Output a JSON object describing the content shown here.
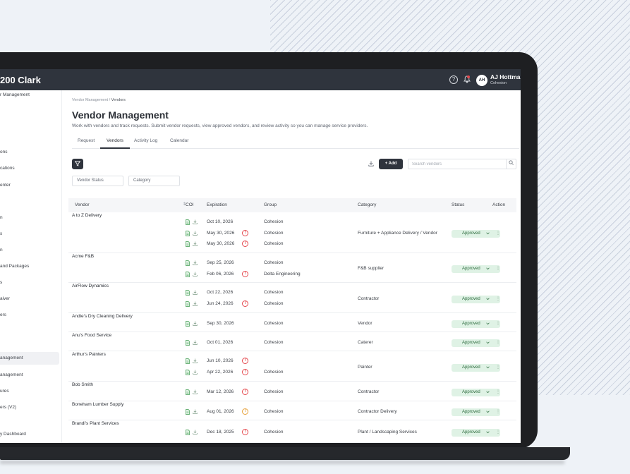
{
  "app": {
    "brand": "200 Clark",
    "user_initials": "AH",
    "user_name": "AJ Hottman",
    "user_org": "Cohesion"
  },
  "colors": {
    "topbar": "#2f343d",
    "status_approved_bg": "#dff2e5",
    "warning": "#e5484d",
    "caution": "#e7a33e",
    "coi_icon": "#3e9b4f"
  },
  "icons": {
    "help": "help-circle-icon",
    "bell": "bell-icon",
    "filter": "filter-icon",
    "download": "download-icon",
    "search": "search-icon",
    "sort": "sort-icon",
    "file": "file-icon",
    "warning": "warning-icon",
    "chevron": "chevron-down-icon",
    "more": "more-vertical-icon"
  },
  "sidebar": {
    "items": [
      {
        "label": "r Management",
        "active": false
      },
      {
        "label": "ons",
        "active": false
      },
      {
        "label": "cations",
        "active": false
      },
      {
        "label": "enter",
        "active": false
      },
      {
        "label": "n",
        "active": false
      },
      {
        "label": "s",
        "active": false
      },
      {
        "label": "n",
        "active": false
      },
      {
        "label": "and Packages",
        "active": false
      },
      {
        "label": "s",
        "active": false
      },
      {
        "label": "aiver",
        "active": false
      },
      {
        "label": "ers",
        "active": false
      },
      {
        "label": "anagement",
        "active": true
      },
      {
        "label": "anagement",
        "active": false
      },
      {
        "label": "ures",
        "active": false
      },
      {
        "label": "ers (V2)",
        "active": false
      },
      {
        "label": "y Dashboard",
        "active": false
      }
    ]
  },
  "page": {
    "breadcrumb_parent": "Vendor Management",
    "breadcrumb_sep": " / ",
    "breadcrumb_current": "Vendors",
    "title": "Vendor Management",
    "description": "Work with vendors and track requests. Submit vendor requests, view approved vendors, and review activity so you can manage service providers."
  },
  "tabs": [
    {
      "label": "Request"
    },
    {
      "label": "Vendors"
    },
    {
      "label": "Activity Log"
    },
    {
      "label": "Calendar"
    }
  ],
  "toolbar": {
    "vendor_status": "Vendor Status",
    "category": "Category",
    "add_label": "+ Add",
    "search_placeholder": "Search vendors"
  },
  "table": {
    "headers": [
      "Vendor",
      "COI",
      "Expiration",
      "Group",
      "Category",
      "Status",
      "Action"
    ],
    "rows": [
      {
        "vendor": "A to Z Delivery",
        "category": "Furniture + Appliance Delivery / Vendor",
        "status": "Approved",
        "coi": [
          {
            "exp": "Oct 10, 2026",
            "warn": "",
            "group": "Cohesion"
          },
          {
            "exp": "May 30, 2026",
            "warn": "red",
            "group": "Cohesion"
          },
          {
            "exp": "May 30, 2026",
            "warn": "red",
            "group": "Cohesion"
          }
        ]
      },
      {
        "vendor": "Acme F&B",
        "category": "F&B supplier",
        "status": "Approved",
        "coi": [
          {
            "exp": "Sep 25, 2026",
            "warn": "",
            "group": "Cohesion"
          },
          {
            "exp": "Feb 06, 2026",
            "warn": "red",
            "group": "Delta Engineering"
          }
        ]
      },
      {
        "vendor": "AirFlow Dynamics",
        "category": "Contractor",
        "status": "Approved",
        "coi": [
          {
            "exp": "Oct 22, 2026",
            "warn": "",
            "group": "Cohesion"
          },
          {
            "exp": "Jun 24, 2026",
            "warn": "red",
            "group": "Cohesion"
          }
        ]
      },
      {
        "vendor": "Andie's Dry Cleaning Delivery",
        "category": "Vendor",
        "status": "Approved",
        "coi": [
          {
            "exp": "Sep 30, 2026",
            "warn": "",
            "group": "Cohesion"
          }
        ]
      },
      {
        "vendor": "Anu's Food Service",
        "category": "Caterer",
        "status": "Approved",
        "coi": [
          {
            "exp": "Oct 01, 2026",
            "warn": "",
            "group": "Cohesion"
          }
        ]
      },
      {
        "vendor": "Arthur's Painters",
        "category": "Painter",
        "status": "Approved",
        "coi": [
          {
            "exp": "Jun 10, 2026",
            "warn": "red",
            "group": ""
          },
          {
            "exp": "Apr 22, 2026",
            "warn": "red",
            "group": "Cohesion"
          }
        ]
      },
      {
        "vendor": "Bob Smith",
        "category": "Contractor",
        "status": "Approved",
        "coi": [
          {
            "exp": "Mar 12, 2026",
            "warn": "red",
            "group": "Cohesion"
          }
        ]
      },
      {
        "vendor": "Boneham Lumber Supply",
        "category": "Contractor Delivery",
        "status": "Approved",
        "coi": [
          {
            "exp": "Aug 01, 2026",
            "warn": "amber",
            "group": "Cohesion"
          }
        ]
      },
      {
        "vendor": "Brandi's Plant Services",
        "category": "Plant / Landscaping Services",
        "status": "Approved",
        "coi": [
          {
            "exp": "Dec 18, 2025",
            "warn": "red",
            "group": "Cohesion"
          }
        ]
      }
    ]
  }
}
